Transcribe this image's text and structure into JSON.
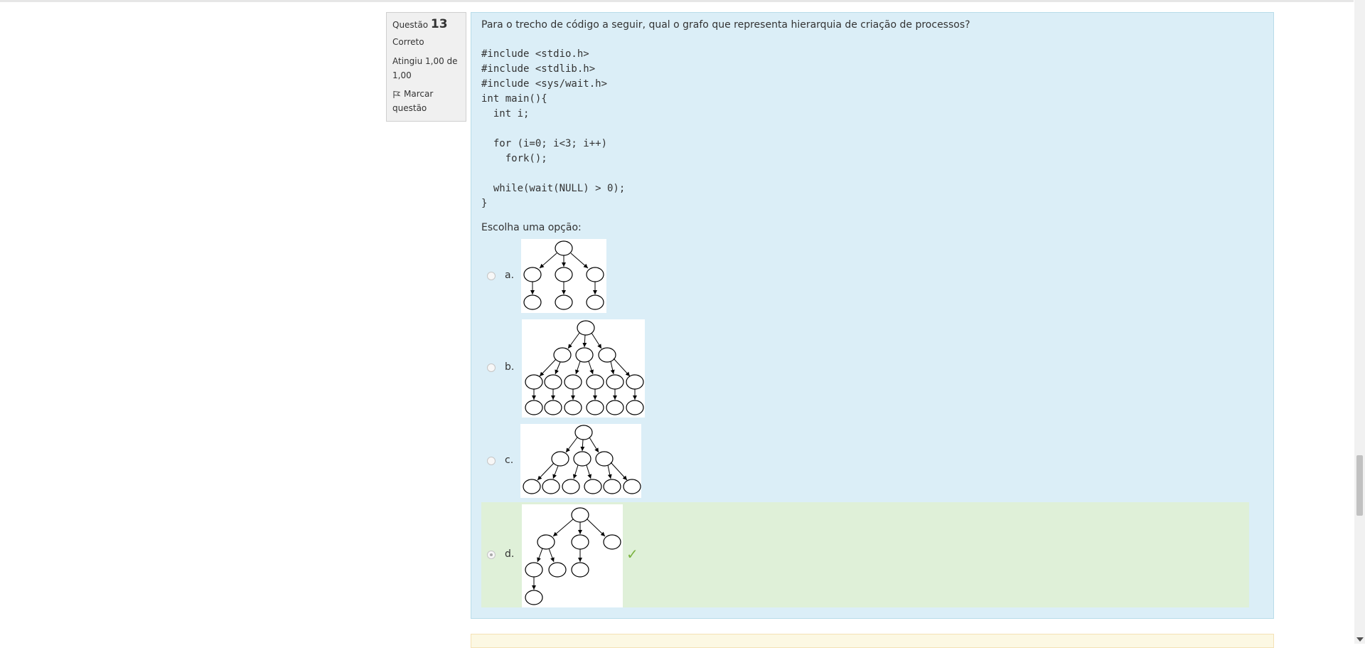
{
  "question": {
    "label": "Questão",
    "number": "13",
    "state": "Correto",
    "grade": "Atingiu 1,00 de 1,00",
    "flag_label": "Marcar questão",
    "text": "Para o trecho de código a seguir, qual o grafo que representa hierarquia de criação de processos?",
    "code": "#include <stdio.h>\n#include <stdlib.h>\n#include <sys/wait.h>\nint main(){\n  int i;\n\n  for (i=0; i<3; i++)\n    fork();\n\n  while(wait(NULL) > 0);\n}",
    "prompt": "Escolha uma opção:"
  },
  "options": [
    {
      "letter": "a.",
      "selected": false,
      "correct": false
    },
    {
      "letter": "b.",
      "selected": false,
      "correct": false
    },
    {
      "letter": "c.",
      "selected": false,
      "correct": false
    },
    {
      "letter": "d.",
      "selected": true,
      "correct": true
    }
  ],
  "colors": {
    "content_bg": "#dbeef7",
    "correct_bg": "#dff0d8",
    "check": "#7cb342",
    "info_bg": "#f0f0f0"
  },
  "icons": {
    "flag": "flag-icon",
    "check": "check-icon"
  }
}
